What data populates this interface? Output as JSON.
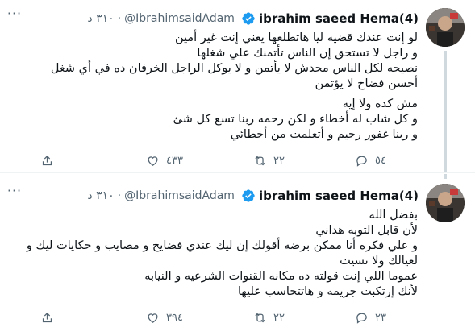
{
  "tweets": [
    {
      "author": {
        "name": "ibrahim saeed Hema(4)",
        "handle": "@IbrahimsaidAdam",
        "verified_icon": "verified-badge-icon",
        "time": "٣١٠ د"
      },
      "lines": [
        "لو إنت عندك قضيه ليا هاتطلعها يعني إنت غير أمين",
        "و راجل لا تستحق إن الناس تأتمنك علي شغلها",
        "نصيحه لكل الناس محدش لا يأتمن و لا يوكل الراجل الخرفان ده في أي شغل",
        "أحسن فضاح لا يؤتمن",
        "",
        "مش كده ولا إيه",
        "و كل شاب له أخطاء و لكن رحمه ربنا تسع كل شئ",
        "و ربنا غفور رحيم    و أتعلمت من أخطائي"
      ],
      "counts": {
        "reply": "٥٤",
        "retweet": "٢٢",
        "like": "٤٣٣"
      }
    },
    {
      "author": {
        "name": "ibrahim saeed Hema(4)",
        "handle": "@IbrahimsaidAdam",
        "verified_icon": "verified-badge-icon",
        "time": "٣١٠ د"
      },
      "lines": [
        "بفضل الله",
        "لأن قابل التوبه هداني",
        "و علي فكره أنا ممكن برضه أقولك إن ليك عندي فضايح و مصايب و حكايات  ليك و",
        "لعيالك ولا نسيت",
        "عموما اللي إنت  قولته ده مكانه القنوات الشرعيه و النيابه",
        "لأنك إرتكبت جريمه و هاتتحاسب عليها"
      ],
      "counts": {
        "reply": "٢٣",
        "retweet": "٢٢",
        "like": "٣٩٤"
      }
    }
  ],
  "colors": {
    "text": "#0f1419",
    "muted": "#536471",
    "verified": "#1d9bf0",
    "divider": "#eff3f4"
  }
}
